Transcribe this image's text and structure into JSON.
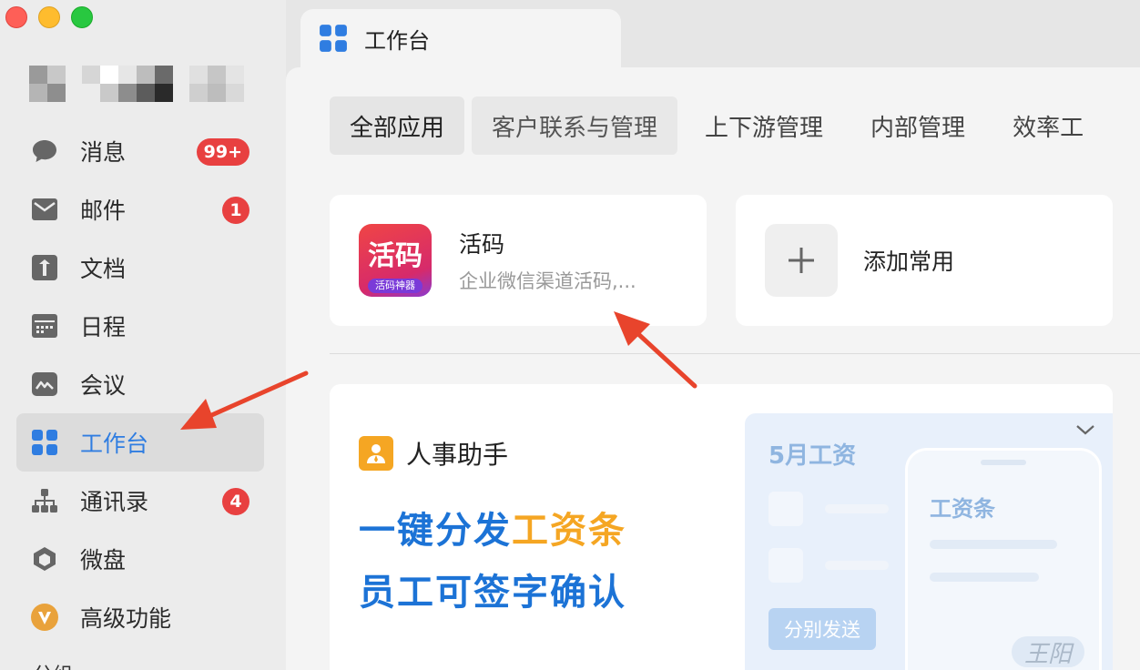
{
  "window": {
    "tab_title": "工作台"
  },
  "sidebar": {
    "items": [
      {
        "label": "消息",
        "icon": "chat-bubble-icon",
        "badge": "99+"
      },
      {
        "label": "邮件",
        "icon": "mail-icon",
        "badge": "1"
      },
      {
        "label": "文档",
        "icon": "document-icon",
        "badge": ""
      },
      {
        "label": "日程",
        "icon": "calendar-icon",
        "badge": ""
      },
      {
        "label": "会议",
        "icon": "meeting-icon",
        "badge": ""
      },
      {
        "label": "工作台",
        "icon": "workbench-grid-icon",
        "badge": "",
        "active": true
      },
      {
        "label": "通讯录",
        "icon": "contacts-tree-icon",
        "badge": "4"
      },
      {
        "label": "微盘",
        "icon": "cloud-drive-icon",
        "badge": ""
      },
      {
        "label": "高级功能",
        "icon": "vip-badge-icon",
        "badge": ""
      }
    ],
    "group_label": "分组"
  },
  "categories": [
    "全部应用",
    "客户联系与管理",
    "上下游管理",
    "内部管理",
    "效率工"
  ],
  "apps": [
    {
      "name": "活码",
      "description": "企业微信渠道活码,...",
      "logo_text": "活码",
      "logo_subtext": "活码神器"
    }
  ],
  "add_card": {
    "label": "添加常用"
  },
  "hr_banner": {
    "title": "人事助手",
    "line1_prefix": "一键分发",
    "line1_highlight": "工资条",
    "line2": "员工可签字确认",
    "preview": {
      "month_title": "5月工资",
      "send_button": "分别发送",
      "phone_title": "工资条",
      "signature": "王阳"
    }
  },
  "colors": {
    "accent": "#2f7de1",
    "badge": "#e84040",
    "highlight": "#f5a623",
    "banner_blue": "#1c73d6",
    "annotation_arrow": "#e8442c"
  }
}
